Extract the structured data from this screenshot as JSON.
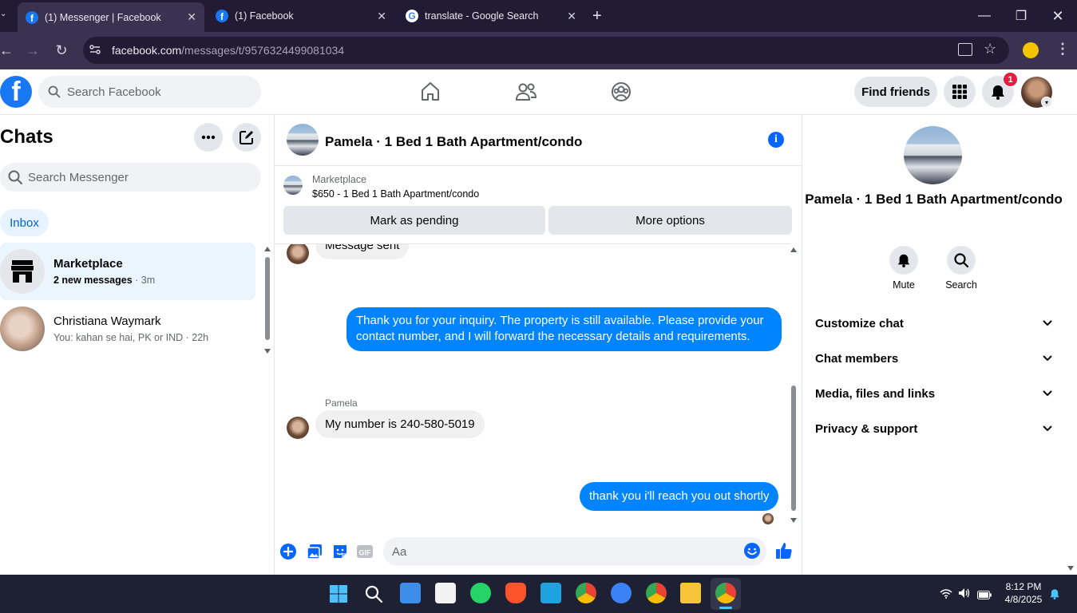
{
  "browser": {
    "tabs": [
      {
        "title": "(1) Messenger | Facebook",
        "active": true
      },
      {
        "title": "(1) Facebook",
        "active": false
      },
      {
        "title": "translate - Google Search",
        "active": false
      }
    ],
    "url_host": "facebook.com",
    "url_path": "/messages/t/9576324499081034"
  },
  "fb": {
    "search_placeholder": "Search Facebook",
    "find_friends": "Find friends",
    "notification_count": "1"
  },
  "chats": {
    "title": "Chats",
    "search_placeholder": "Search Messenger",
    "inbox_label": "Inbox",
    "list": [
      {
        "name": "Marketplace",
        "snippet": "2 new messages",
        "time": "3m",
        "selected": true
      },
      {
        "name": "Christiana Waymark",
        "snippet": "You: kahan se hai, PK or IND",
        "time": "22h",
        "selected": false
      }
    ]
  },
  "conversation": {
    "title": "Pamela · 1 Bed 1 Bath Apartment/condo",
    "marketplace_label": "Marketplace",
    "listing": "$650 - 1 Bed 1 Bath Apartment/condo",
    "mark_pending": "Mark as pending",
    "more_options": "More options",
    "messages": [
      {
        "from": "them",
        "text": "Message sent"
      },
      {
        "from": "me",
        "text": "Thank you for your inquiry. The property is still available. Please provide your contact number, and I will forward the necessary details and requirements."
      },
      {
        "from": "them",
        "sender": "Pamela",
        "text": "My number is 240-580-5019"
      },
      {
        "from": "me",
        "text": "thank you i'll reach you out shortly"
      }
    ],
    "composer_placeholder": "Aa"
  },
  "details": {
    "title": "Pamela · 1 Bed 1 Bath Apartment/condo",
    "mute_label": "Mute",
    "search_label": "Search",
    "sections": [
      "Customize chat",
      "Chat members",
      "Media, files and links",
      "Privacy & support"
    ]
  },
  "taskbar": {
    "time": "8:12 PM",
    "date": "4/8/2025"
  },
  "colors": {
    "fb_blue": "#1877f2",
    "bubble_out": "#0084ff",
    "bubble_in": "#f0f0f0",
    "notif_red": "#e41e3f"
  }
}
